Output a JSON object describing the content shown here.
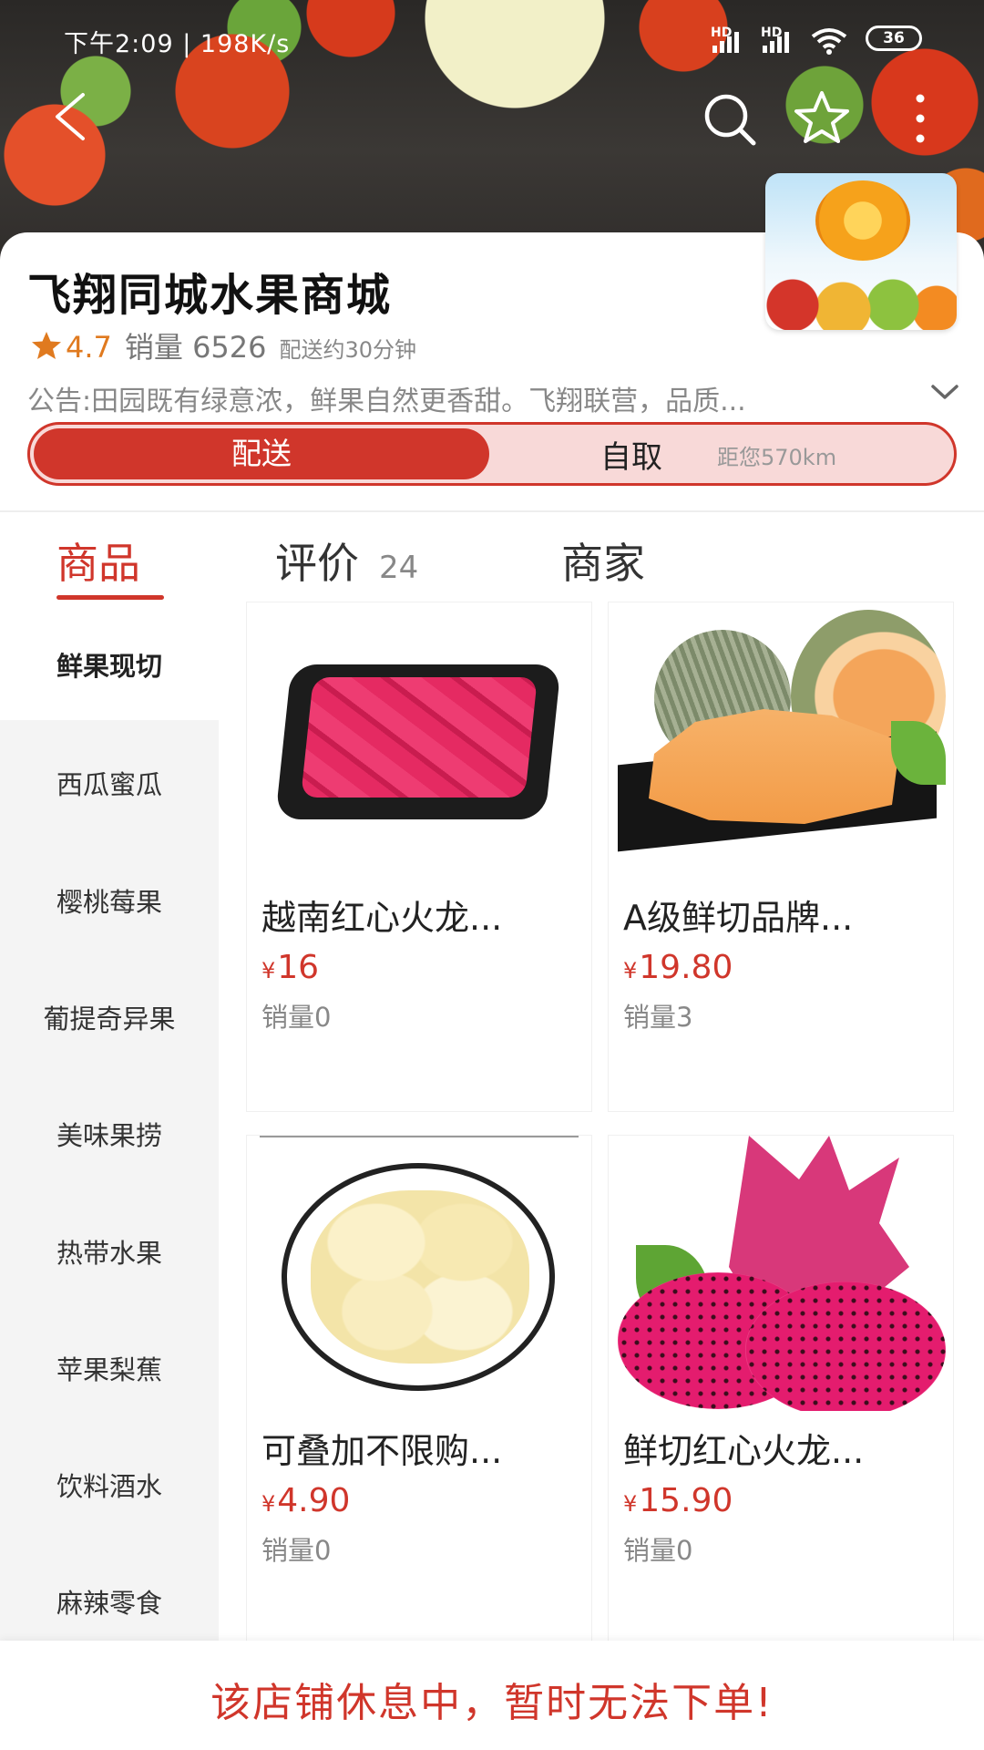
{
  "status_bar": {
    "time": "下午2:09 | 198K/s",
    "hd1": "HD",
    "hd2": "HD",
    "battery": "36"
  },
  "store": {
    "name": "飞翔同城水果商城",
    "rating": "4.7",
    "sales": "销量 6526",
    "delivery_time": "配送约30分钟",
    "notice": "公告:田园既有绿意浓，鲜果自然更香甜。飞翔联营，品质..."
  },
  "mode_toggle": {
    "delivery": "配送",
    "pickup": "自取",
    "distance": "距您570km",
    "selected": "delivery"
  },
  "tabs": [
    {
      "label": "商品",
      "active": true
    },
    {
      "label": "评价",
      "count": "24"
    },
    {
      "label": "商家"
    }
  ],
  "categories": [
    {
      "label": "鲜果现切",
      "active": true
    },
    {
      "label": "西瓜蜜瓜"
    },
    {
      "label": "樱桃莓果"
    },
    {
      "label": "葡提奇异果"
    },
    {
      "label": "美味果捞"
    },
    {
      "label": "热带水果"
    },
    {
      "label": "苹果梨蕉"
    },
    {
      "label": "饮料酒水"
    },
    {
      "label": "麻辣零食"
    }
  ],
  "products": [
    {
      "name": "越南红心火龙...",
      "currency": "¥",
      "price": "16",
      "sold": "销量0"
    },
    {
      "name": "A级鲜切品牌...",
      "currency": "¥",
      "price": "19.80",
      "sold": "销量3"
    },
    {
      "name": "可叠加不限购...",
      "currency": "¥",
      "price": "4.90",
      "sold": "销量0"
    },
    {
      "name": "鲜切红心火龙...",
      "currency": "¥",
      "price": "15.90",
      "sold": "销量0"
    }
  ],
  "bottom_bar": {
    "message": "该店铺休息中，暂时无法下单!"
  },
  "colors": {
    "accent": "#d0362b",
    "accent_light": "#f8d9d8",
    "rating": "#e07a1f",
    "muted": "#888888",
    "sidebar_bg": "#f4f4f4"
  },
  "icons": {
    "back": "back-arrow-icon",
    "search": "search-icon",
    "favorite": "star-outline-icon",
    "more": "more-vertical-icon",
    "rating": "star-filled-icon",
    "expand": "chevron-down-icon"
  }
}
